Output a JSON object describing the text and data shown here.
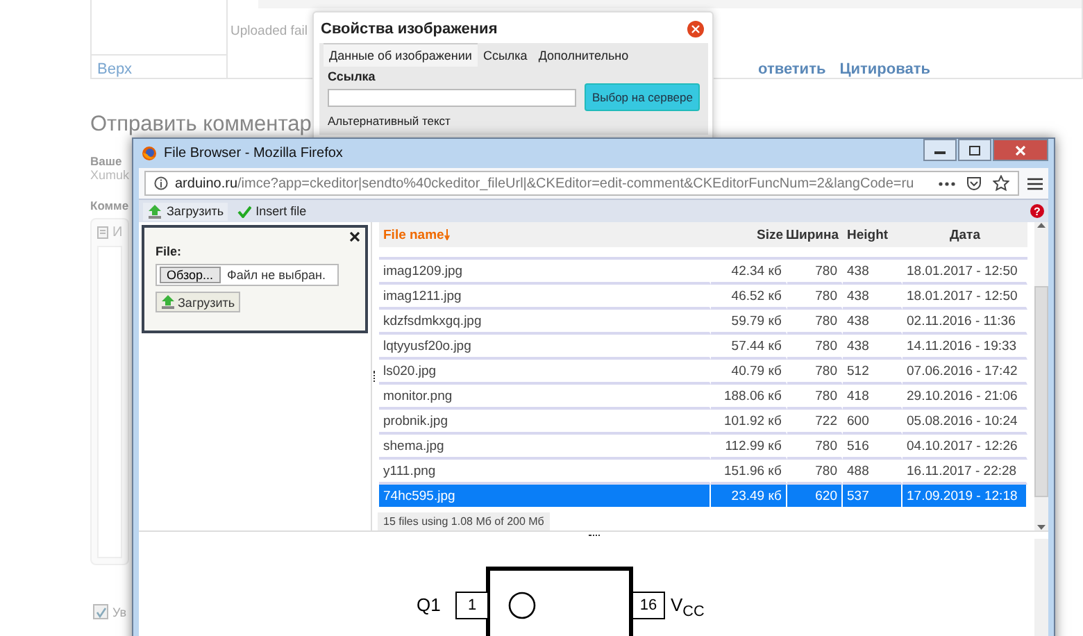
{
  "page": {
    "table_text": "Uploaded fail",
    "top_link": "Верх",
    "actions": [
      "ответить",
      "Цитировать"
    ],
    "heading": "Отправить комментар",
    "name_label": "Ваше",
    "name_value": "Xumuk",
    "comment_label": "Комме",
    "editor_button": "И",
    "notify": {
      "label": "Ув",
      "checked": true
    }
  },
  "image_dialog": {
    "title": "Свойства изображения",
    "tabs": [
      {
        "label": "Данные об изображении",
        "selected": true
      },
      {
        "label": "Ссылка",
        "selected": false
      },
      {
        "label": "Дополнительно",
        "selected": false
      }
    ],
    "url_label": "Ссылка",
    "browse_server_button": "Выбор на сервере",
    "alt_label": "Альтернативный текст"
  },
  "browser": {
    "title": "File Browser - Mozilla Firefox",
    "url_host": "arduino.ru",
    "url_path": "/imce?app=ckeditor|sendto%40ckeditor_fileUrl|&CKEditor=edit-comment&CKEditorFuncNum=2&langCode=ru",
    "toolbar": [
      {
        "label": "Загрузить",
        "kind": "upload"
      },
      {
        "label": "Insert file",
        "kind": "insert"
      }
    ],
    "help": "?",
    "upload_panel": {
      "file_label": "File:",
      "browse_button": "Обзор...",
      "no_file_text": "Файл не выбран.",
      "upload_button": "Загрузить"
    },
    "file_table": {
      "columns": [
        {
          "label": "File name",
          "sorted": true
        },
        {
          "label": "Size",
          "sorted": false
        },
        {
          "label": "Ширина",
          "sorted": false
        },
        {
          "label": "Height",
          "sorted": false
        },
        {
          "label": "Дата",
          "sorted": false
        }
      ],
      "rows": [
        {
          "cells": [
            "imag1209.jpg",
            "42.34 кб",
            "780",
            "438",
            "18.01.2017 - 12:50"
          ],
          "selected": false
        },
        {
          "cells": [
            "imag1211.jpg",
            "46.52 кб",
            "780",
            "438",
            "18.01.2017 - 12:50"
          ],
          "selected": false
        },
        {
          "cells": [
            "kdzfsdmkxgq.jpg",
            "59.79 кб",
            "780",
            "438",
            "02.11.2016 - 11:36"
          ],
          "selected": false
        },
        {
          "cells": [
            "lqtyyusf20o.jpg",
            "57.44 кб",
            "780",
            "438",
            "14.11.2016 - 19:33"
          ],
          "selected": false
        },
        {
          "cells": [
            "ls020.jpg",
            "40.79 кб",
            "780",
            "512",
            "07.06.2016 - 17:42"
          ],
          "selected": false
        },
        {
          "cells": [
            "monitor.png",
            "188.06 кб",
            "780",
            "418",
            "29.10.2016 - 21:06"
          ],
          "selected": false
        },
        {
          "cells": [
            "probnik.jpg",
            "101.92 кб",
            "722",
            "600",
            "05.08.2016 - 10:24"
          ],
          "selected": false
        },
        {
          "cells": [
            "shema.jpg",
            "112.99 кб",
            "780",
            "516",
            "04.10.2017 - 12:26"
          ],
          "selected": false
        },
        {
          "cells": [
            "y111.png",
            "151.96 кб",
            "780",
            "488",
            "16.11.2017 - 22:28"
          ],
          "selected": false
        },
        {
          "cells": [
            "74hc595.jpg",
            "23.49 кб",
            "620",
            "537",
            "17.09.2019 - 12:18"
          ],
          "selected": true
        }
      ]
    },
    "status": "15 files using 1.08 Мб of 200 Мб",
    "preview": {
      "left_label": "Q1",
      "left_pin": "1",
      "right_pin": "16",
      "right_label": "V$_{CC}$"
    }
  }
}
